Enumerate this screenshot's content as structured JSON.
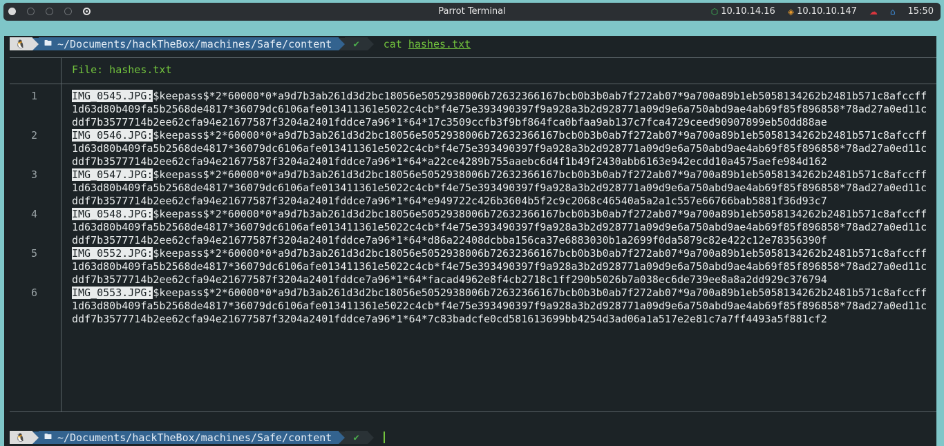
{
  "topbar": {
    "title": "Parrot Terminal",
    "vpn_ip": "10.10.14.16",
    "target_ip": "10.10.10.147",
    "time": "15:50"
  },
  "prompt": {
    "os_icon": "linux-icon",
    "path": "~/Documents/hackTheBox/machines/Safe/content",
    "status": "✔",
    "command": "cat",
    "argument": "hashes.txt"
  },
  "file_header": "File: hashes.txt",
  "lines": [
    {
      "num": "1",
      "file": "IMG_0545.JPG:",
      "hash": "$keepass$*2*60000*0*a9d7b3ab261d3d2bc18056e5052938006b72632366167bcb0b3b0ab7f272ab07*9a700a89b1eb5058134262b2481b571c8afccff1d63d80b409fa5b2568de4817*36079dc6106afe013411361e5022c4cb*f4e75e393490397f9a928a3b2d928771a09d9e6a750abd9ae4ab69f85f896858*78ad27a0ed11cddf7b3577714b2ee62cfa94e21677587f3204a2401fddce7a96*1*64*17c3509ccfb3f9bf864fca0bfaa9ab137c7fca4729ceed90907899eb50dd88ae"
    },
    {
      "num": "2",
      "file": "IMG_0546.JPG:",
      "hash": "$keepass$*2*60000*0*a9d7b3ab261d3d2bc18056e5052938006b72632366167bcb0b3b0ab7f272ab07*9a700a89b1eb5058134262b2481b571c8afccff1d63d80b409fa5b2568de4817*36079dc6106afe013411361e5022c4cb*f4e75e393490397f9a928a3b2d928771a09d9e6a750abd9ae4ab69f85f896858*78ad27a0ed11cddf7b3577714b2ee62cfa94e21677587f3204a2401fddce7a96*1*64*a22ce4289b755aaebc6d4f1b49f2430abb6163e942ecdd10a4575aefe984d162"
    },
    {
      "num": "3",
      "file": "IMG_0547.JPG:",
      "hash": "$keepass$*2*60000*0*a9d7b3ab261d3d2bc18056e5052938006b72632366167bcb0b3b0ab7f272ab07*9a700a89b1eb5058134262b2481b571c8afccff1d63d80b409fa5b2568de4817*36079dc6106afe013411361e5022c4cb*f4e75e393490397f9a928a3b2d928771a09d9e6a750abd9ae4ab69f85f896858*78ad27a0ed11cddf7b3577714b2ee62cfa94e21677587f3204a2401fddce7a96*1*64*e949722c426b3604b5f2c9c2068c46540a5a2a1c557e66766bab5881f36d93c7"
    },
    {
      "num": "4",
      "file": "IMG_0548.JPG:",
      "hash": "$keepass$*2*60000*0*a9d7b3ab261d3d2bc18056e5052938006b72632366167bcb0b3b0ab7f272ab07*9a700a89b1eb5058134262b2481b571c8afccff1d63d80b409fa5b2568de4817*36079dc6106afe013411361e5022c4cb*f4e75e393490397f9a928a3b2d928771a09d9e6a750abd9ae4ab69f85f896858*78ad27a0ed11cddf7b3577714b2ee62cfa94e21677587f3204a2401fddce7a96*1*64*d86a22408dcbba156ca37e6883030b1a2699f0da5879c82e422c12e78356390f"
    },
    {
      "num": "5",
      "file": "IMG_0552.JPG:",
      "hash": "$keepass$*2*60000*0*a9d7b3ab261d3d2bc18056e5052938006b72632366167bcb0b3b0ab7f272ab07*9a700a89b1eb5058134262b2481b571c8afccff1d63d80b409fa5b2568de4817*36079dc6106afe013411361e5022c4cb*f4e75e393490397f9a928a3b2d928771a09d9e6a750abd9ae4ab69f85f896858*78ad27a0ed11cddf7b3577714b2ee62cfa94e21677587f3204a2401fddce7a96*1*64*facad4962e8f4cb2718c1ff290b5026b7a038ec6de739ee8a8a2dd929c376794"
    },
    {
      "num": "6",
      "file": "IMG_0553.JPG:",
      "hash": "$keepass$*2*60000*0*a9d7b3ab261d3d2bc18056e5052938006b72632366167bcb0b3b0ab7f272ab07*9a700a89b1eb5058134262b2481b571c8afccff1d63d80b409fa5b2568de4817*36079dc6106afe013411361e5022c4cb*f4e75e393490397f9a928a3b2d928771a09d9e6a750abd9ae4ab69f85f896858*78ad27a0ed11cddf7b3577714b2ee62cfa94e21677587f3204a2401fddce7a96*1*64*7c83badcfe0cd581613699bb4254d3ad06a1a517e2e81c7a7ff4493a5f881cf2"
    }
  ],
  "colors": {
    "terminal_bg": "#1c2326",
    "path_segment": "#33638f",
    "accent_green": "#72c33d"
  }
}
